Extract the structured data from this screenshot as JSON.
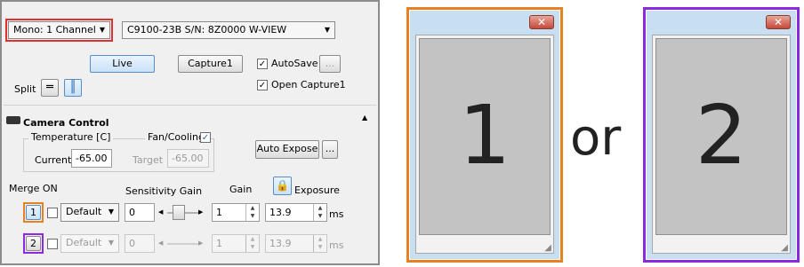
{
  "toolbar": {
    "mode_select": "Mono: 1 Channel",
    "camera_select": "C9100-23B S/N: 8Z0000 W-VIEW",
    "live_label": "Live",
    "capture_label": "Capture1",
    "autosave_label": "AutoSave",
    "autosave_checked": "✓",
    "browse_label": "...",
    "open_capture_label": "Open Capture1",
    "open_capture_checked": "✓",
    "split_label": "Split"
  },
  "camera_control": {
    "title": "Camera Control",
    "temperature_label": "Temperature [C]",
    "fan_label": "Fan/Cooling",
    "fan_checked": "✓",
    "current_label": "Current",
    "current_value": "-65.00",
    "target_label": "Target",
    "target_value": "-65.00",
    "auto_expose_label": "Auto Expose",
    "more_label": "..."
  },
  "channels_header": {
    "merge_label": "Merge ON",
    "sensitivity_label": "Sensitivity Gain",
    "gain_label": "Gain",
    "exposure_label": "Exposure"
  },
  "channels": [
    {
      "number": "1",
      "preset": "Default",
      "sensitivity": "0",
      "gain": "1",
      "exposure": "13.9",
      "unit": "ms"
    },
    {
      "number": "2",
      "preset": "Default",
      "sensitivity": "0",
      "gain": "1",
      "exposure": "13.9",
      "unit": "ms"
    }
  ],
  "windows": [
    {
      "label": "1",
      "close": "✕",
      "accent": "#e8821e"
    },
    {
      "label": "2",
      "close": "✕",
      "accent": "#8a2be2"
    }
  ],
  "or_text": "or",
  "colors": {
    "highlight_red": "#e03030",
    "channel1_orange": "#e8821e",
    "channel2_purple": "#8a2be2"
  }
}
